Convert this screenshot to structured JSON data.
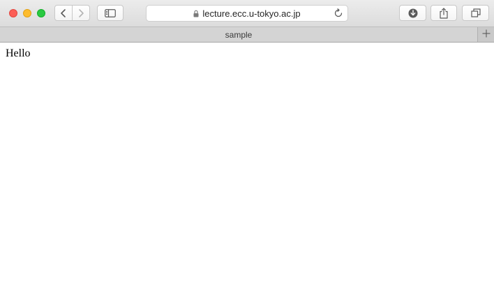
{
  "browser": {
    "address_bar": {
      "url": "lecture.ecc.u-tokyo.ac.jp"
    },
    "tab": {
      "title": "sample"
    },
    "icons": {
      "close": "close-traffic-light",
      "minimize": "minimize-traffic-light",
      "zoom": "zoom-traffic-light",
      "back": "chevron-left-icon",
      "forward": "chevron-right-icon",
      "sidebar": "sidebar-icon",
      "lock": "lock-icon",
      "reload": "reload-icon",
      "downloads": "download-icon",
      "share": "share-icon",
      "tabs": "tabs-overview-icon",
      "new_tab": "plus-icon"
    },
    "colors": {
      "close": "#fc5f57",
      "minimize": "#fdbc2e",
      "zoom": "#29c941"
    }
  },
  "page": {
    "text": "Hello"
  }
}
